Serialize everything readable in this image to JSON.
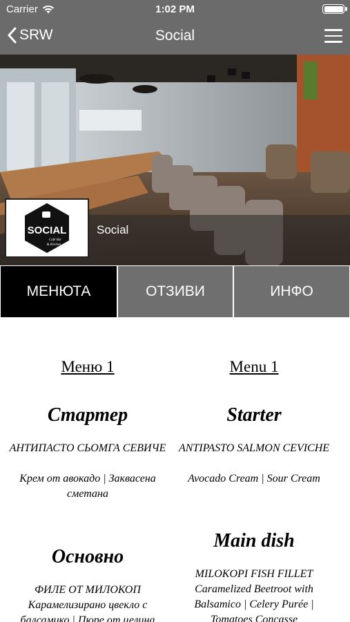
{
  "status_bar": {
    "carrier": "Carrier",
    "time": "1:02 PM"
  },
  "nav": {
    "back_label": "SRW",
    "title": "Social"
  },
  "venue": {
    "name": "Social",
    "logo_text": "SOCIAL",
    "logo_subtext": "Café Bar & Kitchen"
  },
  "tabs": [
    {
      "label": "МЕНЮТА",
      "active": true
    },
    {
      "label": "ОТЗИВИ",
      "active": false
    },
    {
      "label": "ИНФО",
      "active": false
    }
  ],
  "menu": {
    "left": {
      "title": "Меню 1",
      "sections": [
        {
          "name": "Стартер",
          "dish_name": "АНТИПАСТО СЬОМГА СЕВИЧЕ",
          "dish_desc": "Крем от авокадо | Заквасена сметана"
        },
        {
          "name": "Основно",
          "dish_name": "ФИЛЕ ОТ МИЛОКОП",
          "dish_desc": "Карамелизирано цвекло с балсамико | Пюре от целина"
        }
      ]
    },
    "right": {
      "title": "Menu 1",
      "sections": [
        {
          "name": "Starter",
          "dish_name": "ANTIPASTO SALMON CEVICHE",
          "dish_desc": "Avocado Cream | Sour Cream"
        },
        {
          "name": "Main dish",
          "dish_name": "MILOKOPI FISH FILLET",
          "dish_desc": "Caramelized Beetroot with Balsamico | Celery Purée | Tomatoes Concasse"
        }
      ]
    }
  },
  "colors": {
    "header": "#6b6b6b",
    "tab_active": "#000000",
    "tab_inactive": "#6f6f6f"
  }
}
